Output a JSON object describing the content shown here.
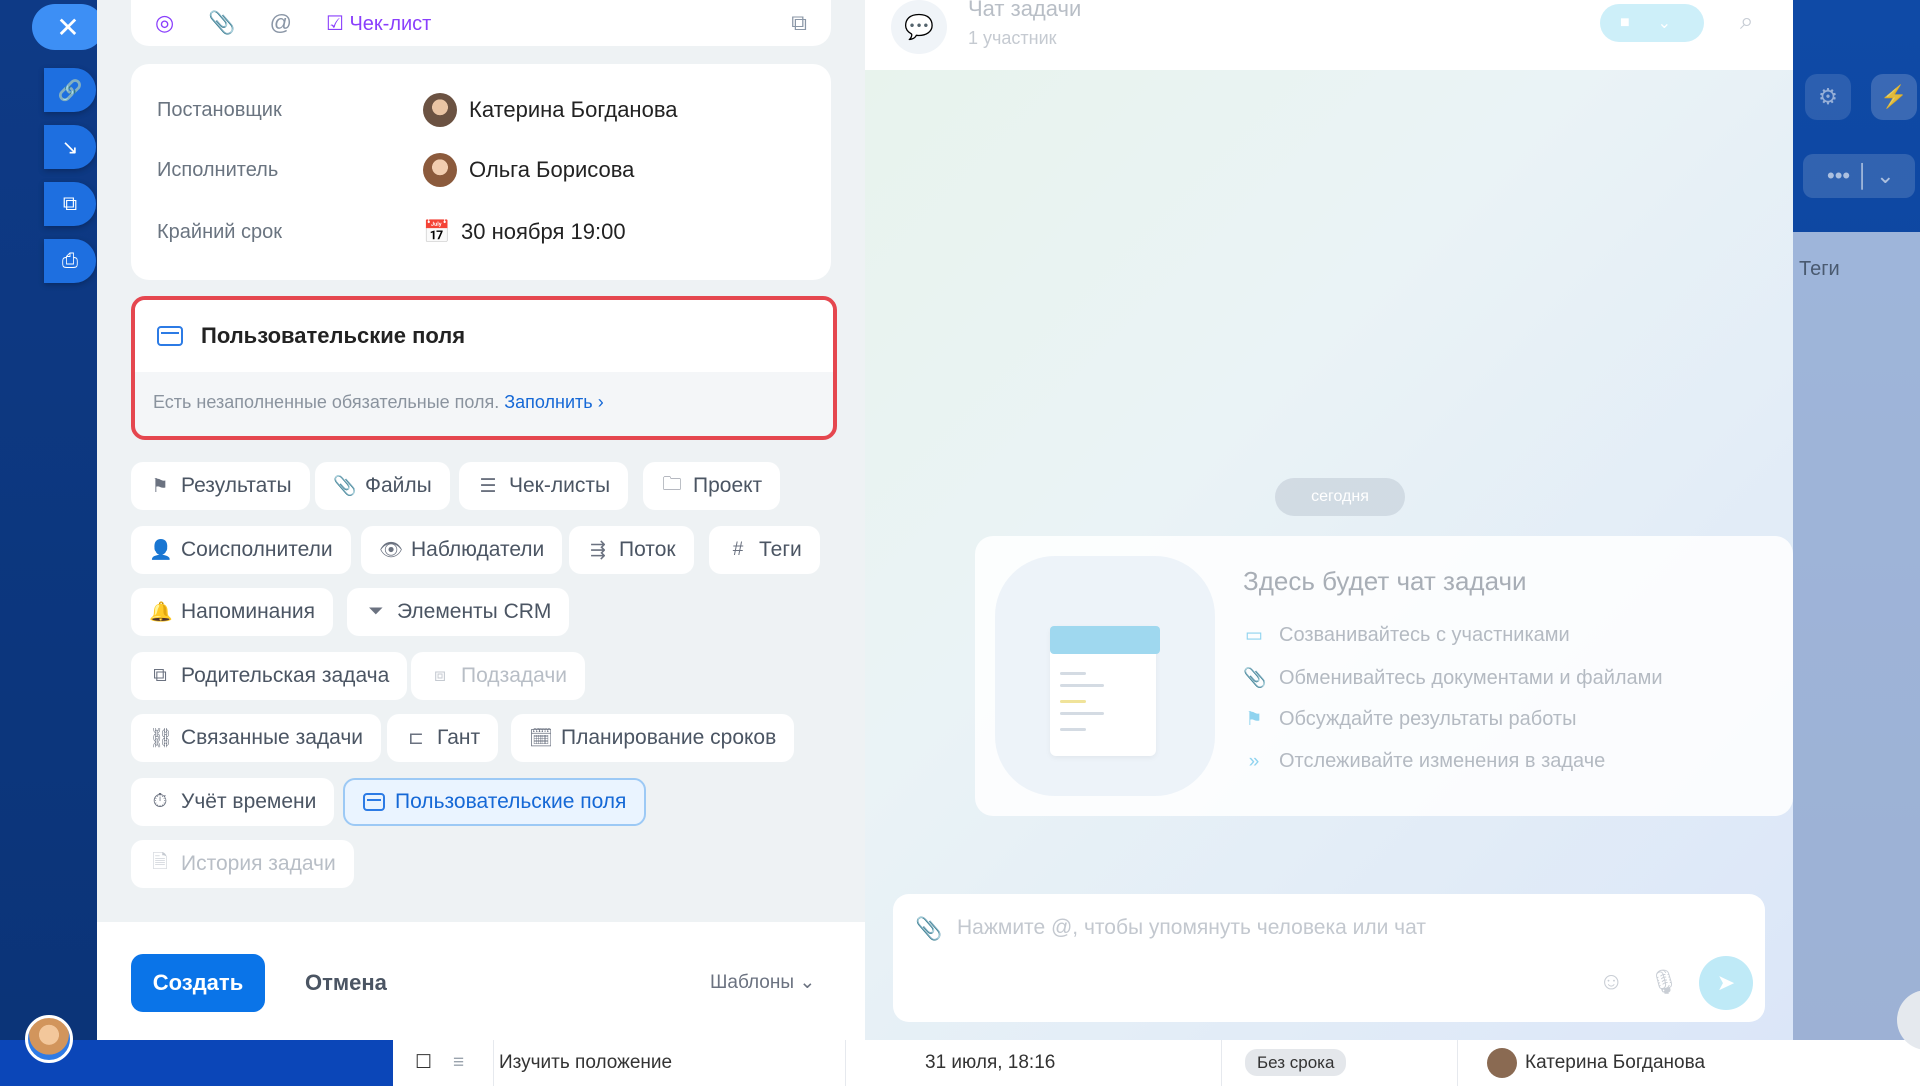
{
  "toolbar": {
    "checklist_label": "Чек-лист"
  },
  "people": {
    "creator_label": "Постановщик",
    "creator_name": "Катерина Богданова",
    "assignee_label": "Исполнитель",
    "assignee_name": "Ольга Борисова",
    "deadline_label": "Крайний срок",
    "deadline_value": "30 ноября 19:00"
  },
  "user_fields": {
    "title": "Пользовательские поля",
    "note": "Есть незаполненные обязательные поля.",
    "fill_link": "Заполнить"
  },
  "chips": [
    {
      "label": "Результаты",
      "icon": "flag-icon"
    },
    {
      "label": "Файлы",
      "icon": "clip-icon"
    },
    {
      "label": "Чек-листы",
      "icon": "checklist-icon"
    },
    {
      "label": "Проект",
      "icon": "folder-icon"
    },
    {
      "label": "Соисполнители",
      "icon": "person-icon"
    },
    {
      "label": "Наблюдатели",
      "icon": "eye-icon"
    },
    {
      "label": "Поток",
      "icon": "flow-icon"
    },
    {
      "label": "Теги",
      "icon": "hash-icon"
    },
    {
      "label": "Напоминания",
      "icon": "bell-icon"
    },
    {
      "label": "Элементы CRM",
      "icon": "funnel-icon"
    },
    {
      "label": "Родительская задача",
      "icon": "parent-task-icon"
    },
    {
      "label": "Подзадачи",
      "icon": "subtask-icon"
    },
    {
      "label": "Связанные задачи",
      "icon": "link-icon"
    },
    {
      "label": "Гант",
      "icon": "gantt-icon"
    },
    {
      "label": "Планирование сроков",
      "icon": "calendar-clock-icon"
    },
    {
      "label": "Учёт времени",
      "icon": "timer-icon"
    },
    {
      "label": "Пользовательские поля",
      "icon": "user-fields-icon"
    },
    {
      "label": "История задачи",
      "icon": "history-icon"
    }
  ],
  "footer": {
    "create_label": "Создать",
    "cancel_label": "Отмена",
    "templates_label": "Шаблоны"
  },
  "chat": {
    "title": "Чат задачи",
    "subtitle": "1 участник",
    "date_pill": "сегодня",
    "card_title": "Здесь будет чат задачи",
    "card_items": [
      "Созванивайтесь с участниками",
      "Обменивайтесь документами и файлами",
      "Обсуждайте результаты работы",
      "Отслеживайте изменения в задаче"
    ],
    "composer_placeholder": "Нажмите @, чтобы упомянуть человека или чат"
  },
  "background": {
    "tags_label": "Теги",
    "row_task": "Изучить положение",
    "row_date": "31 июля, 18:16",
    "row_deadline": "Без срока",
    "row_person": "Катерина Богданова"
  },
  "colors": {
    "accent": "#0a74e8",
    "alert_border": "#e5474f",
    "checklist_purple": "#8a3ffc"
  }
}
